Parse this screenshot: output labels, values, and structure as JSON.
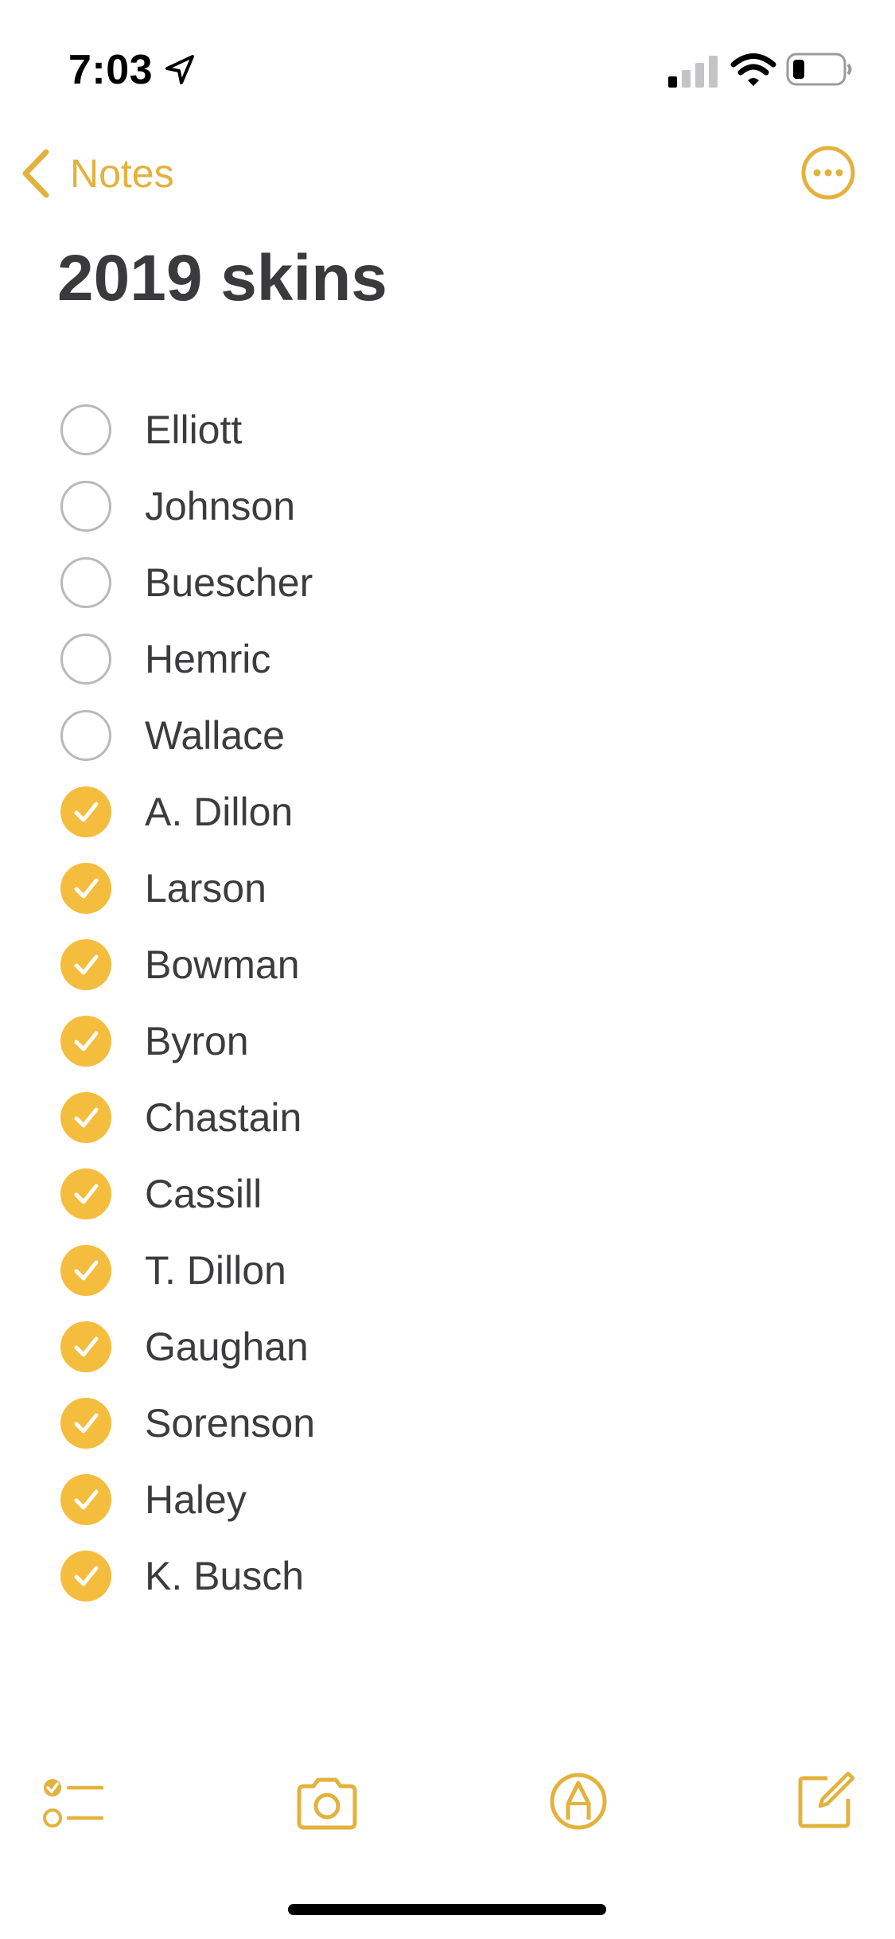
{
  "status_bar": {
    "time": "7:03",
    "icons": [
      "location-arrow-icon",
      "cellular-signal-icon",
      "wifi-icon",
      "battery-icon"
    ]
  },
  "nav": {
    "back_label": "Notes",
    "back_icon": "chevron-left-icon",
    "more_icon": "ellipsis-circle-icon"
  },
  "note": {
    "title": "2019 skins",
    "checklist": [
      {
        "label": "Elliott",
        "checked": false
      },
      {
        "label": "Johnson",
        "checked": false
      },
      {
        "label": "Buescher",
        "checked": false
      },
      {
        "label": "Hemric",
        "checked": false
      },
      {
        "label": "Wallace",
        "checked": false
      },
      {
        "label": "A. Dillon",
        "checked": true
      },
      {
        "label": "Larson",
        "checked": true
      },
      {
        "label": "Bowman",
        "checked": true
      },
      {
        "label": "Byron",
        "checked": true
      },
      {
        "label": "Chastain",
        "checked": true
      },
      {
        "label": "Cassill",
        "checked": true
      },
      {
        "label": "T. Dillon",
        "checked": true
      },
      {
        "label": "Gaughan",
        "checked": true
      },
      {
        "label": "Sorenson",
        "checked": true
      },
      {
        "label": "Haley",
        "checked": true
      },
      {
        "label": "K. Busch",
        "checked": true
      }
    ]
  },
  "toolbar": {
    "icons": [
      "checklist-icon",
      "camera-icon",
      "markup-icon",
      "compose-icon"
    ]
  },
  "colors": {
    "accent": "#e3b23c",
    "check_fill": "#f4bd3d",
    "unchecked_border": "#b9b9bd",
    "text": "#3c3c3e"
  }
}
